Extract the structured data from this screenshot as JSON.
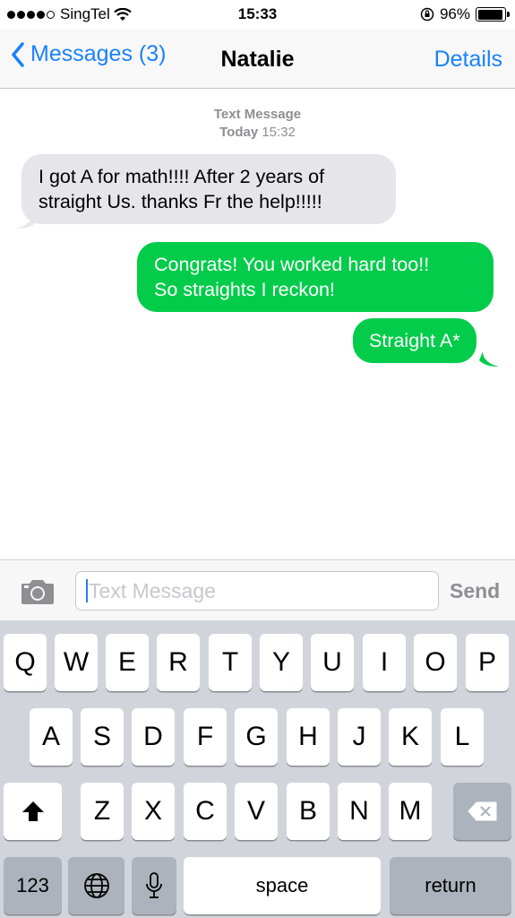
{
  "status": {
    "carrier": "SingTel",
    "time": "15:33",
    "battery": "96%",
    "battery_level": 0.96
  },
  "nav": {
    "back_label": "Messages (3)",
    "title": "Natalie",
    "details_label": "Details"
  },
  "thread": {
    "meta_type": "Text Message",
    "meta_day": "Today",
    "meta_time": "15:32",
    "messages": [
      {
        "side": "incoming",
        "lines": [
          "I got A for math!!!! After 2 years of",
          "straight Us. thanks Fr the help!!!!!"
        ]
      },
      {
        "side": "outgoing",
        "lines": [
          "Congrats! You worked hard too!!",
          "So straights I reckon!"
        ]
      },
      {
        "side": "outgoing",
        "lines": [
          "Straight A*"
        ]
      }
    ]
  },
  "composer": {
    "placeholder": "Text Message",
    "send_label": "Send"
  },
  "keyboard": {
    "row1": [
      "Q",
      "W",
      "E",
      "R",
      "T",
      "Y",
      "U",
      "I",
      "O",
      "P"
    ],
    "row2": [
      "A",
      "S",
      "D",
      "F",
      "G",
      "H",
      "J",
      "K",
      "L"
    ],
    "row3": [
      "Z",
      "X",
      "C",
      "V",
      "B",
      "N",
      "M"
    ],
    "numbers_label": "123",
    "space_label": "space",
    "return_label": "return"
  }
}
